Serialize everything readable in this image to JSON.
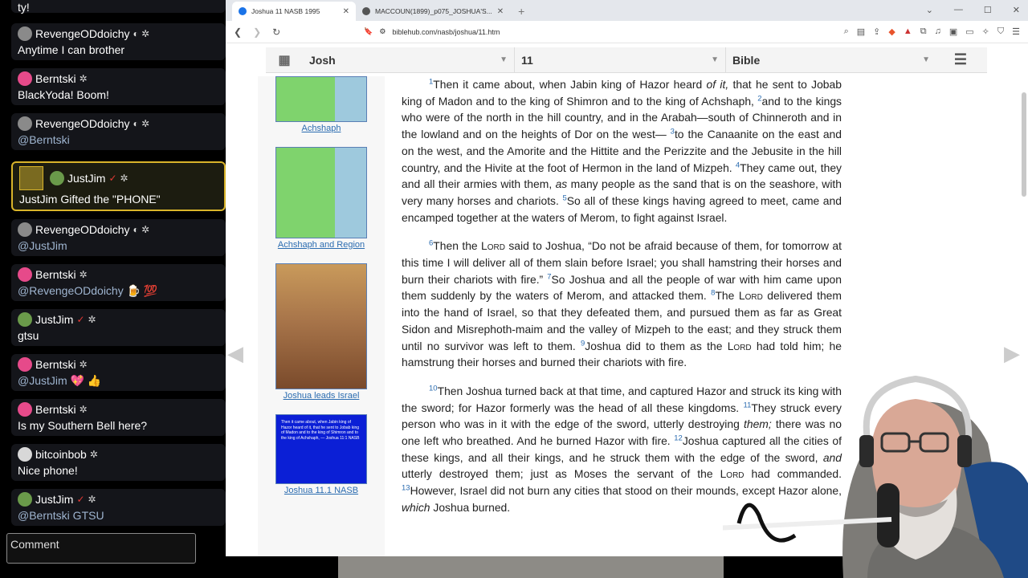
{
  "chat": {
    "top_partial": "ty!",
    "messages": [
      {
        "user": "RevengeODdoichy",
        "text": "Anytime I can brother",
        "mention": false
      },
      {
        "user": "Berntski",
        "text": "BlackYoda! Boom!",
        "mention": false
      },
      {
        "user": "RevengeODdoichy",
        "text": "@Berntski",
        "mention": true
      },
      {
        "user": "JustJim",
        "text": "JustJim Gifted the \"PHONE\"",
        "mention": false,
        "gift": true
      },
      {
        "user": "RevengeODdoichy",
        "text": "@JustJim",
        "mention": true
      },
      {
        "user": "Berntski",
        "text": "@RevengeODdoichy 🍺 💯",
        "mention": true
      },
      {
        "user": "JustJim",
        "text": "gtsu",
        "mention": false
      },
      {
        "user": "Berntski",
        "text": "@JustJim 💖 👍",
        "mention": true
      },
      {
        "user": "Berntski",
        "text": "Is my Southern Bell here?",
        "mention": false
      },
      {
        "user": "bitcoinbob",
        "text": "Nice phone!",
        "mention": false
      },
      {
        "user": "JustJim",
        "text": "@Berntski GTSU",
        "mention": true
      }
    ],
    "comment_placeholder": "Comment"
  },
  "browser": {
    "tabs": [
      {
        "title": "Joshua 11 NASB 1995",
        "active": true
      },
      {
        "title": "MACCOUN(1899)_p075_JOSHUA'S...",
        "active": false
      }
    ],
    "new_tab": "+",
    "url": "biblehub.com/nasb/joshua/11.htm"
  },
  "nav": {
    "book": "Josh",
    "chapter": "11",
    "version": "Bible"
  },
  "thumbs": [
    {
      "caption": "Achshaph"
    },
    {
      "caption": "Achshaph and Region"
    },
    {
      "caption": "Joshua leads Israel"
    },
    {
      "caption": "Joshua 11.1 NASB",
      "image_text": "Then it came about, when Jabin king of Hazor heard of it, that he sent to Jobab king of Madon and to the king of Shimron and to the king of Achshaph, — Joshua 11:1 NASB"
    }
  ],
  "scripture": {
    "p1": {
      "v1": "1",
      "t1": "Then it came about, when Jabin king of Hazor heard ",
      "t1i": "of it,",
      "t1b": " that he sent to Jobab king of Madon and to the king of Shimron and to the king of Achshaph, ",
      "v2": "2",
      "t2": "and to the kings who were of the north in the hill country, and in the Arabah—south of Chinneroth and in the lowland and on the heights of Dor on the west— ",
      "v3": "3",
      "t3": "to the Canaanite on the east and on the west, and the Amorite and the Hittite and the Perizzite and the Jebusite in the hill country, and the Hivite at the foot of Hermon in the land of Mizpeh. ",
      "v4": "4",
      "t4": "They came out, they and all their armies with them, ",
      "t4i": "as",
      "t4b": " many people as the sand that is on the seashore, with very many horses and chariots. ",
      "v5": "5",
      "t5": "So all of these kings having agreed to meet, came and encamped together at the waters of Merom, to fight against Israel."
    },
    "p2": {
      "v6": "6",
      "t6a": "Then the ",
      "lord": "Lord",
      "t6b": " said to Joshua, “Do not be afraid because of them, for tomorrow at this time I will deliver all of them slain before Israel; you shall hamstring their horses and burn their chariots with fire.” ",
      "v7": "7",
      "t7": "So Joshua and all the people of war with him came upon them suddenly by the waters of Merom, and attacked them. ",
      "v8": "8",
      "t8a": "The ",
      "t8b": " delivered them into the hand of Israel, so that they defeated them, and pursued them as far as Great Sidon and Misrephoth-maim and the valley of Mizpeh to the east; and they struck them until no survivor was left to them. ",
      "v9": "9",
      "t9a": "Joshua did to them as the ",
      "t9b": " had told him; he hamstrung their horses and burned their chariots with fire."
    },
    "p3": {
      "v10": "10",
      "t10": "Then Joshua turned back at that time, and captured Hazor and struck its king with the sword; for Hazor formerly was the head of all these kingdoms. ",
      "v11": "11",
      "t11a": "They struck every person who was in it with the edge of the sword, utterly destroying ",
      "t11i": "them;",
      "t11b": " there was no one left who breathed. And he burned Hazor with fire. ",
      "v12": "12",
      "t12a": "Joshua captured all the cities of these kings, and all their kings, and he struck them with the edge of the sword, ",
      "t12i": "and",
      "t12b": " utterly destroyed them; just as Moses the servant of the ",
      "t12c": " had commanded. ",
      "v13": "13",
      "t13a": "However, Israel did not burn any cities that stood on their mounds, except Hazor alone, ",
      "t13i": "which",
      "t13b": " Joshua burned."
    }
  },
  "colors": {
    "link": "#2b6cb0",
    "gift_border": "#d9b42a",
    "verify": "#e53935"
  }
}
